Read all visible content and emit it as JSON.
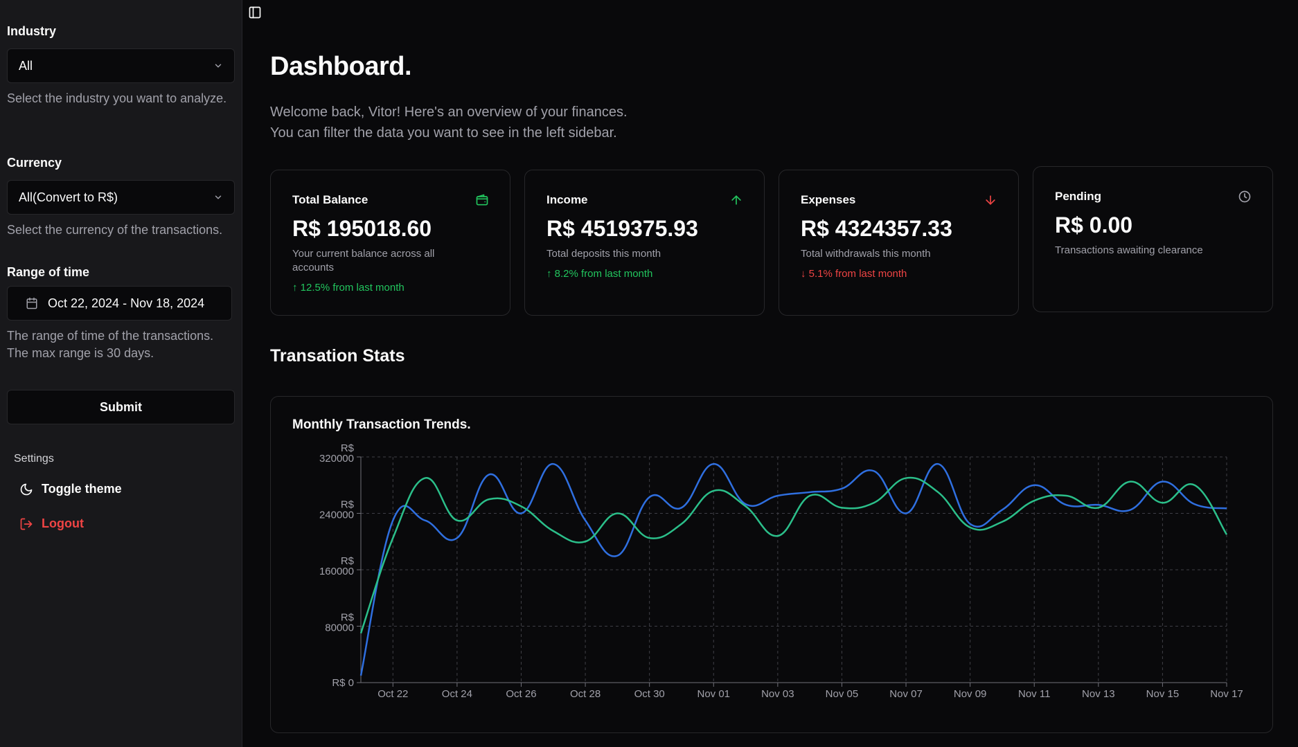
{
  "sidebar": {
    "industry_label": "Industry",
    "industry_value": "All",
    "industry_help": "Select the industry you want to analyze.",
    "currency_label": "Currency",
    "currency_value": "All(Convert to R$)",
    "currency_help": "Select the currency of the transactions.",
    "range_label": "Range of time",
    "range_value": "Oct 22, 2024 - Nov 18, 2024",
    "range_help": "The range of time of the transactions. The max range is 30 days.",
    "submit_label": "Submit",
    "settings_title": "Settings",
    "toggle_theme_label": "Toggle theme",
    "logout_label": "Logout"
  },
  "header": {
    "title": "Dashboard.",
    "welcome_line1": "Welcome back, Vitor! Here's an overview of your finances.",
    "welcome_line2": "You can filter the data you want to see in the left sidebar."
  },
  "cards": [
    {
      "title": "Total Balance",
      "value": "R$ 195018.60",
      "desc": "Your current balance across all accounts",
      "trend": "↑ 12.5% from last month",
      "icon": "wallet-icon"
    },
    {
      "title": "Income",
      "value": "R$ 4519375.93",
      "desc": "Total deposits this month",
      "trend": "↑ 8.2% from last month",
      "icon": "arrow-up-icon"
    },
    {
      "title": "Expenses",
      "value": "R$ 4324357.33",
      "desc": "Total withdrawals this month",
      "trend": "↓ 5.1% from last month",
      "icon": "arrow-down-icon"
    },
    {
      "title": "Pending",
      "value": "R$ 0.00",
      "desc": "Transactions awaiting clearance",
      "trend": "",
      "icon": "clock-icon"
    }
  ],
  "colors": {
    "accent_green": "#22c55e",
    "accent_red": "#ef4444",
    "series_income": "#2f6fe0",
    "series_expenses": "#2bbf8a"
  },
  "section_title": "Transation Stats",
  "chart_title": "Monthly Transaction Trends.",
  "chart_data": {
    "type": "line",
    "ylim": [
      0,
      320000
    ],
    "y_ticks": [
      {
        "value": 0,
        "label": "R$ 0"
      },
      {
        "value": 80000,
        "label": "R$ 80000"
      },
      {
        "value": 160000,
        "label": "R$ 160000"
      },
      {
        "value": 240000,
        "label": "R$ 240000"
      },
      {
        "value": 320000,
        "label": "R$ 320000"
      }
    ],
    "x_labels": [
      "Oct 22",
      "Oct 24",
      "Oct 26",
      "Oct 28",
      "Oct 30",
      "Nov 01",
      "Nov 03",
      "Nov 05",
      "Nov 07",
      "Nov 09",
      "Nov 11",
      "Nov 13",
      "Nov 15",
      "Nov 17"
    ],
    "x_range": [
      "Oct 21",
      "Nov 17"
    ],
    "categories": [
      "Oct 21",
      "Oct 22",
      "Oct 23",
      "Oct 24",
      "Oct 25",
      "Oct 26",
      "Oct 27",
      "Oct 28",
      "Oct 29",
      "Oct 30",
      "Oct 31",
      "Nov 01",
      "Nov 02",
      "Nov 03",
      "Nov 04",
      "Nov 05",
      "Nov 06",
      "Nov 07",
      "Nov 08",
      "Nov 09",
      "Nov 10",
      "Nov 11",
      "Nov 12",
      "Nov 13",
      "Nov 14",
      "Nov 15",
      "Nov 16",
      "Nov 17"
    ],
    "grid": true,
    "series": [
      {
        "values": [
          10000,
          230000,
          230000,
          205000,
          295000,
          240000,
          310000,
          230000,
          180000,
          263000,
          248000,
          310000,
          253000,
          265000,
          270000,
          275000,
          300000,
          240000,
          310000,
          225000,
          245000,
          280000,
          252000,
          252000,
          245000,
          285000,
          253000,
          247000
        ]
      },
      {
        "values": [
          70000,
          205000,
          290000,
          230000,
          260000,
          250000,
          215000,
          200000,
          240000,
          205000,
          225000,
          272000,
          250000,
          208000,
          265000,
          248000,
          255000,
          290000,
          270000,
          220000,
          228000,
          258000,
          265000,
          248000,
          285000,
          255000,
          280000,
          210000
        ]
      }
    ]
  }
}
